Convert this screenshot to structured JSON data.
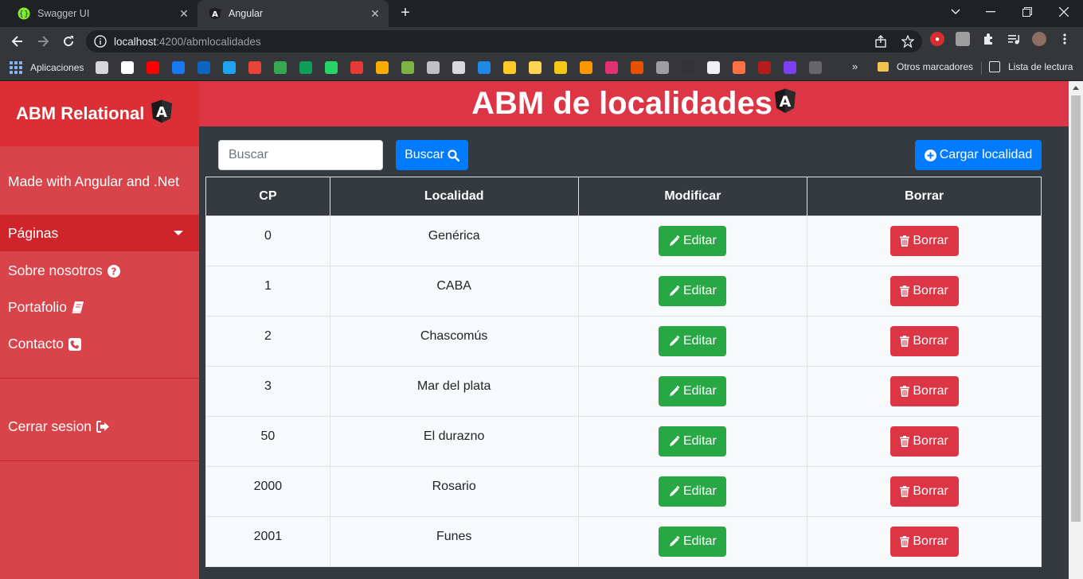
{
  "browser": {
    "tabs": [
      {
        "title": "Swagger UI",
        "icon": "swagger-icon",
        "active": false
      },
      {
        "title": "Angular",
        "icon": "angular-icon",
        "active": true
      }
    ],
    "address": {
      "host": "localhost",
      "path": ":4200/abmlocalidades"
    },
    "bookmarks": {
      "apps_label": "Aplicaciones",
      "folder_label": "Otros marcadores",
      "reading_list_label": "Lista de lectura",
      "favicon_colors": [
        "#d7d7d7",
        "#ffffff",
        "#ff0000",
        "#1877f2",
        "#0a66c2",
        "#1da1f2",
        "#ea4335",
        "#34a853",
        "#0f9d58",
        "#25d366",
        "#e53935",
        "#f9ab00",
        "#7cb342",
        "#c0c0c0",
        "#d9d9d9",
        "#1e88e5",
        "#ffca28",
        "#ffd54f",
        "#f5c518",
        "#ff9800",
        "#e1306c",
        "#e65100",
        "#9e9e9e",
        "#333333",
        "#f0f0f0",
        "#ff7043",
        "#b71c1c",
        "#7e3ff2",
        "#666666"
      ]
    }
  },
  "sidebar": {
    "brand": "ABM Relational",
    "made_with": "Made with Angular and .Net",
    "pages_label": "Páginas",
    "links": [
      {
        "label": "Sobre nosotros",
        "icon": "question-circle-icon"
      },
      {
        "label": "Portafolio",
        "icon": "book-icon"
      },
      {
        "label": "Contacto",
        "icon": "phone-icon"
      }
    ],
    "logout_label": "Cerrar sesion"
  },
  "header": {
    "title": "ABM de localidades"
  },
  "toolbar": {
    "search_placeholder": "Buscar",
    "search_button": "Buscar",
    "add_button": "Cargar localidad"
  },
  "table": {
    "headers": [
      "CP",
      "Localidad",
      "Modificar",
      "Borrar"
    ],
    "edit_label": "Editar",
    "delete_label": "Borrar",
    "rows": [
      {
        "cp": "0",
        "localidad": "Genérica"
      },
      {
        "cp": "1",
        "localidad": "CABA"
      },
      {
        "cp": "2",
        "localidad": "Chascomús"
      },
      {
        "cp": "3",
        "localidad": "Mar del plata"
      },
      {
        "cp": "50",
        "localidad": "El durazno"
      },
      {
        "cp": "2000",
        "localidad": "Rosario"
      },
      {
        "cp": "2001",
        "localidad": "Funes"
      }
    ]
  },
  "colors": {
    "primary": "#007bff",
    "success": "#28a745",
    "danger": "#dc3545",
    "dark": "#343a40"
  }
}
